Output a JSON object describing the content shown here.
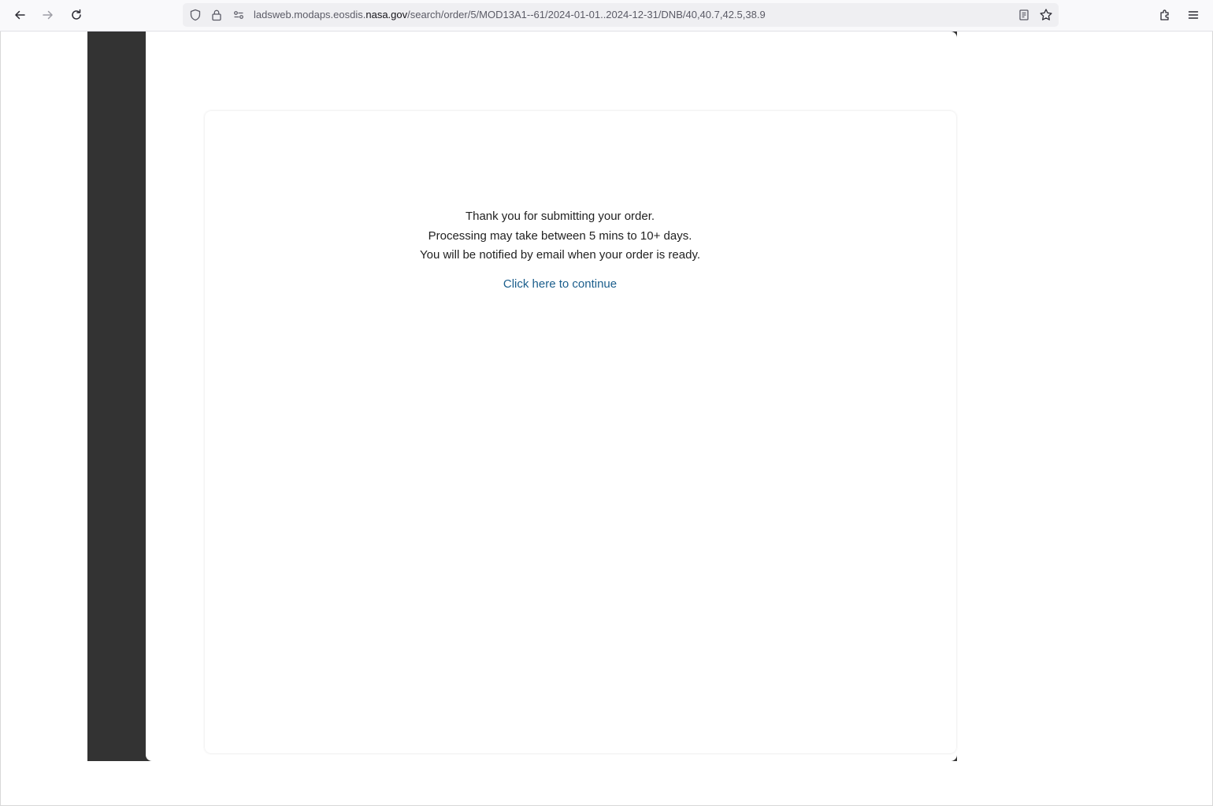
{
  "browser": {
    "url_prefix": "ladsweb.modaps.eosdis.",
    "url_domain": "nasa.gov",
    "url_suffix": "/search/order/5/MOD13A1--61/2024-01-01..2024-12-31/DNB/40,40.7,42.5,38.9"
  },
  "order_confirmation": {
    "line1": "Thank you for submitting your order.",
    "line2": "Processing may take between 5 mins to 10+ days.",
    "line3": "You will be notified by email when your order is ready.",
    "continue_link": "Click here to continue"
  },
  "colors": {
    "link": "#1b5e8c",
    "backdrop": "#333333"
  }
}
